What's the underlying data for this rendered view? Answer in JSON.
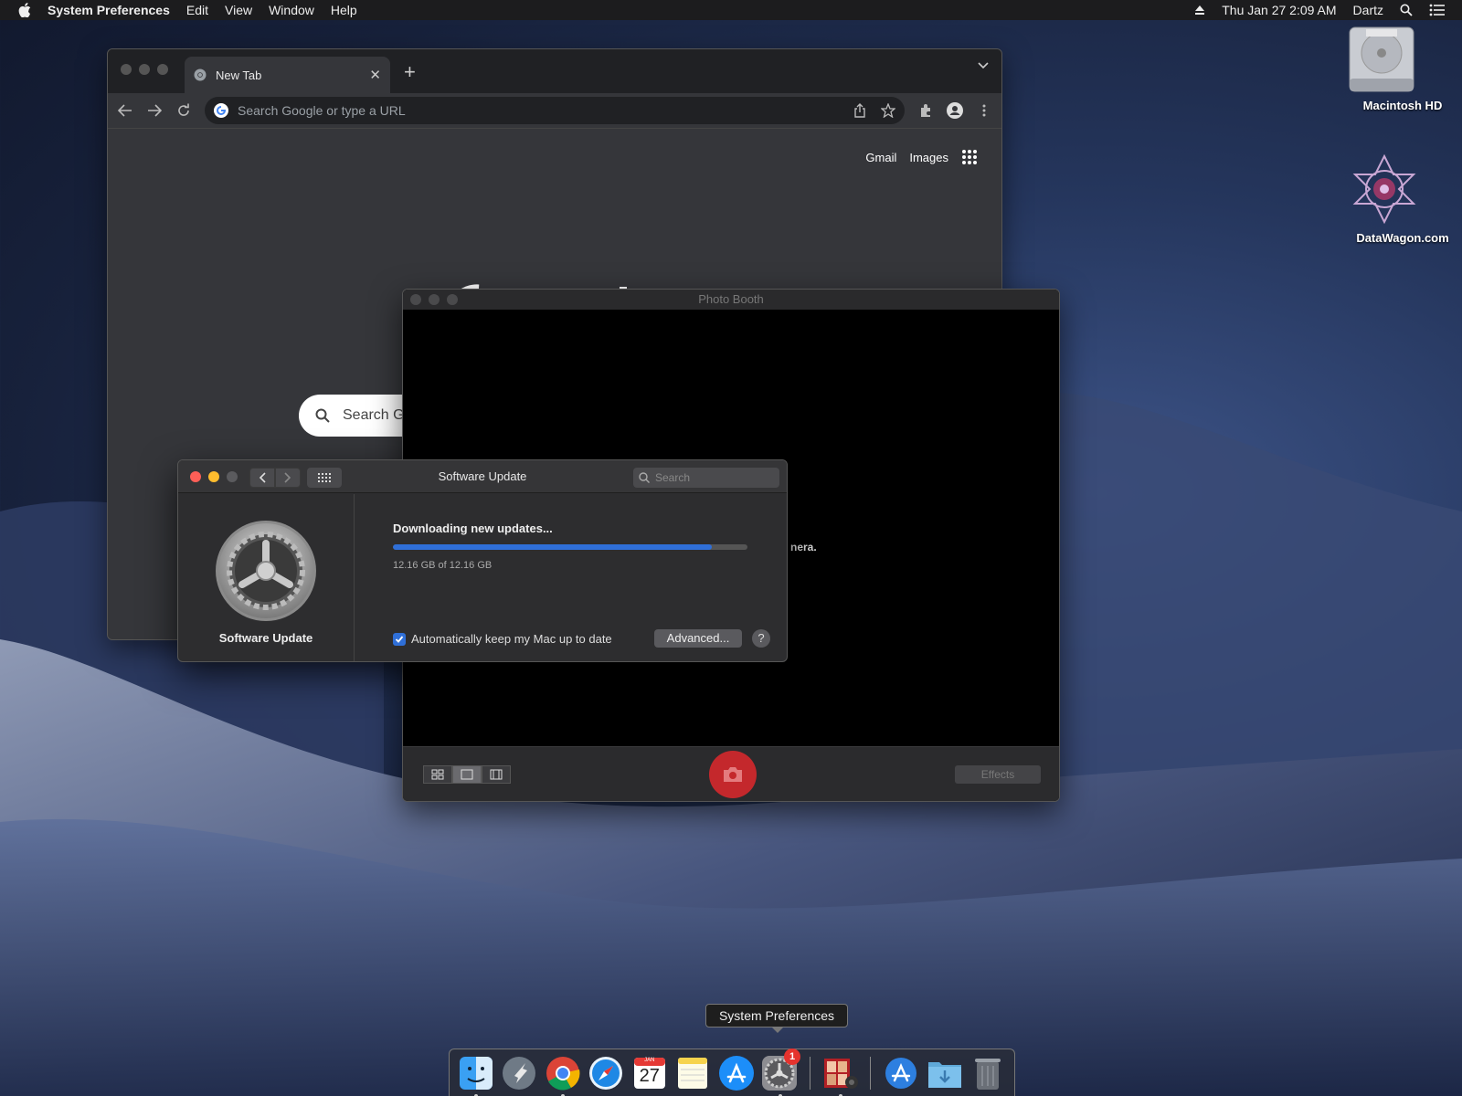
{
  "menubar": {
    "apple_icon": "apple-logo",
    "app_name": "System Preferences",
    "menus": [
      "Edit",
      "View",
      "Window",
      "Help"
    ],
    "datetime": "Thu Jan 27  2:09 AM",
    "user": "Dartz"
  },
  "desktop": {
    "icons": [
      {
        "label": "Macintosh HD",
        "icon": "hard-drive-icon"
      },
      {
        "label": "DataWagon.com",
        "icon": "network-server-icon"
      }
    ]
  },
  "chrome": {
    "tab_title": "New Tab",
    "omnibox_placeholder": "Search Google or type a URL",
    "top_links": {
      "gmail": "Gmail",
      "images": "Images"
    },
    "search_placeholder": "Search G"
  },
  "photobooth": {
    "title": "Photo Booth",
    "camera_message_fragment": "nera.",
    "effects_label": "Effects"
  },
  "software_update": {
    "window_title": "Software Update",
    "search_placeholder": "Search",
    "pane_name": "Software Update",
    "status_title": "Downloading new updates...",
    "progress_fraction": 0.9,
    "size_text": "12.16 GB of 12.16 GB",
    "auto_update_label": "Automatically keep my Mac up to date",
    "auto_update_checked": true,
    "advanced_label": "Advanced...",
    "help_label": "?"
  },
  "dock": {
    "tooltip": "System Preferences",
    "calendar_day": "27",
    "calendar_month": "JAN",
    "sysprefs_badge": "1",
    "items": [
      "finder-icon",
      "launchpad-icon",
      "chrome-icon",
      "safari-icon",
      "calendar-icon",
      "notes-icon",
      "app-store-icon",
      "system-preferences-icon",
      "photo-booth-icon",
      "app-store-downloads-icon",
      "downloads-folder-icon",
      "trash-icon"
    ]
  },
  "colors": {
    "accent_blue": "#2f6fd8",
    "close_red": "#fe5f57",
    "minimize_yellow": "#febc2e",
    "shutter_red": "#c4282c",
    "badge_red": "#e5332e"
  }
}
